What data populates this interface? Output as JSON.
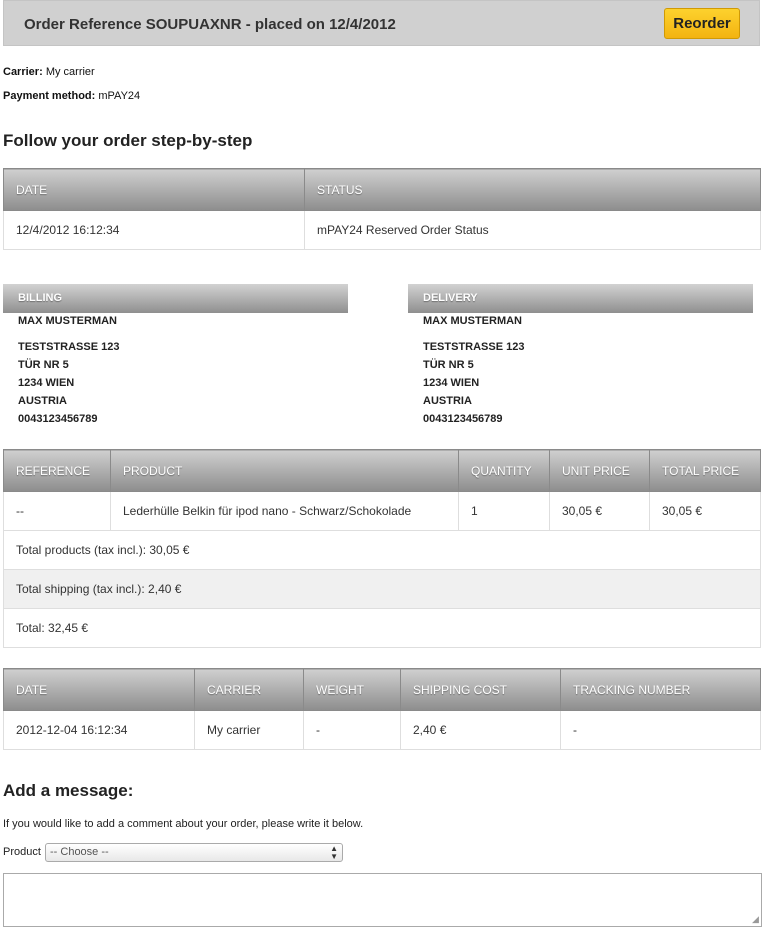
{
  "header": {
    "title": "Order Reference SOUPUAXNR - placed on 12/4/2012",
    "reorder_label": "Reorder"
  },
  "info": {
    "carrier_label": "Carrier:",
    "carrier_value": "My carrier",
    "payment_label": "Payment method:",
    "payment_value": "mPAY24"
  },
  "follow_heading": "Follow your order step-by-step",
  "status_table": {
    "headers": [
      "DATE",
      "STATUS"
    ],
    "rows": [
      [
        "12/4/2012 16:12:34",
        "mPAY24 Reserved Order Status"
      ]
    ]
  },
  "billing": {
    "header": "BILLING",
    "name": "MAX MUSTERMAN",
    "lines": [
      "TESTSTRASSE 123",
      "TÜR NR 5",
      "1234 WIEN",
      "AUSTRIA",
      "0043123456789"
    ]
  },
  "delivery": {
    "header": "DELIVERY",
    "name": "MAX MUSTERMAN",
    "lines": [
      "TESTSTRASSE 123",
      "TÜR NR 5",
      "1234 WIEN",
      "AUSTRIA",
      "0043123456789"
    ]
  },
  "products_table": {
    "headers": [
      "REFERENCE",
      "PRODUCT",
      "QUANTITY",
      "UNIT PRICE",
      "TOTAL PRICE"
    ],
    "rows": [
      [
        "--",
        "Lederhülle Belkin für ipod nano - Schwarz/Schokolade",
        "1",
        "30,05 €",
        "30,05 €"
      ]
    ],
    "total_products": "Total products (tax incl.): 30,05 €",
    "total_shipping": "Total shipping (tax incl.): 2,40 €",
    "total": "Total: 32,45 €"
  },
  "shipping_table": {
    "headers": [
      "DATE",
      "CARRIER",
      "WEIGHT",
      "SHIPPING COST",
      "TRACKING NUMBER"
    ],
    "rows": [
      [
        "2012-12-04 16:12:34",
        "My carrier",
        "-",
        "2,40 €",
        "-"
      ]
    ]
  },
  "message": {
    "heading": "Add a message:",
    "help": "If you would like to add a comment about your order, please write it below.",
    "product_label": "Product",
    "product_selected": "-- Choose --",
    "textarea_value": ""
  },
  "colors": {
    "reorder_button": "#f7c31d",
    "header_bar": "#d0d0d0",
    "table_header_top": "#cfcfcf",
    "table_header_bottom": "#8d8d8d"
  }
}
